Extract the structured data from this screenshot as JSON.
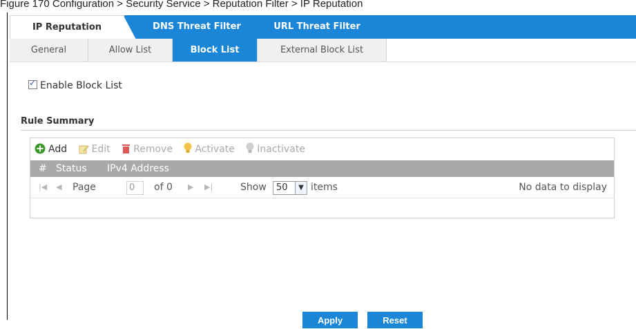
{
  "caption": "Figure 170   Configuration > Security Service > Reputation Filter > IP Reputation",
  "tabs_top": [
    "IP Reputation",
    "DNS Threat Filter",
    "URL Threat Filter"
  ],
  "tabs_sub": [
    "General",
    "Allow List",
    "Block List",
    "External Block List"
  ],
  "enable_label": "Enable Block List",
  "section_title": "Rule Summary",
  "toolbar": {
    "add": "Add",
    "edit": "Edit",
    "remove": "Remove",
    "activate": "Activate",
    "inactivate": "Inactivate"
  },
  "columns": [
    "#",
    "Status",
    "IPv4 Address"
  ],
  "pager": {
    "page_label": "Page",
    "page_value": "0",
    "of_label": "of 0",
    "show_label": "Show",
    "show_value": "50",
    "items_label": "items",
    "empty_text": "No data to display"
  },
  "buttons": {
    "apply": "Apply",
    "reset": "Reset"
  },
  "colors": {
    "accent": "#1b86d8",
    "header_gray": "#a9a9a9"
  }
}
